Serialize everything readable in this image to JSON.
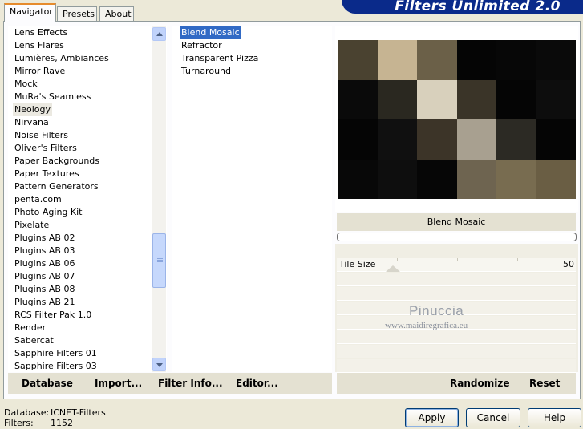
{
  "tabs": [
    {
      "label": "Navigator",
      "active": true
    },
    {
      "label": "Presets",
      "active": false
    },
    {
      "label": "About",
      "active": false
    }
  ],
  "banner": {
    "title": "Filters Unlimited 2.0"
  },
  "categories": [
    "Lens Effects",
    "Lens Flares",
    "Lumières, Ambiances",
    "Mirror Rave",
    "Mock",
    "MuRa's Seamless",
    "Neology",
    "Nirvana",
    "Noise Filters",
    "Oliver's Filters",
    "Paper Backgrounds",
    "Paper Textures",
    "Pattern Generators",
    "penta.com",
    "Photo Aging Kit",
    "Pixelate",
    "Plugins AB 02",
    "Plugins AB 03",
    "Plugins AB 06",
    "Plugins AB 07",
    "Plugins AB 08",
    "Plugins AB 21",
    "RCS Filter Pak 1.0",
    "Render",
    "Sabercat",
    "Sapphire Filters 01",
    "Sapphire Filters 03"
  ],
  "selected_category": "Neology",
  "filters": [
    "Blend Mosaic",
    "Refractor",
    "Transparent Pizza",
    "Turnaround"
  ],
  "selected_filter": "Blend Mosaic",
  "preview": {
    "filter_name": "Blend Mosaic",
    "watermark_line1": "Pinuccia",
    "watermark_line2": "www.maidiregrafica.eu",
    "mosaic_colors": [
      "#4a4230",
      "#c6b492",
      "#6b6048",
      "#050505",
      "#070707",
      "#0a0a0a",
      "#0a0a0a",
      "#2a2820",
      "#d8d0bc",
      "#3a3428",
      "#050505",
      "#0d0d0d",
      "#050505",
      "#101010",
      "#3c3428",
      "#a8a090",
      "#2c2a24",
      "#050505",
      "#080808",
      "#0e0e0e",
      "#060606",
      "#6e6450",
      "#786c50",
      "#6a5e44"
    ]
  },
  "parameters": [
    {
      "label": "Tile Size",
      "value": "50",
      "fraction": 0.2
    }
  ],
  "toolbar": {
    "database": "Database",
    "import": "Import...",
    "filter_info": "Filter Info...",
    "editor": "Editor...",
    "randomize": "Randomize",
    "reset": "Reset"
  },
  "status": {
    "database_label": "Database:",
    "database_value": "ICNET-Filters",
    "filters_label": "Filters:",
    "filters_value": "1152"
  },
  "buttons": {
    "apply": "Apply",
    "cancel": "Cancel",
    "help": "Help"
  }
}
